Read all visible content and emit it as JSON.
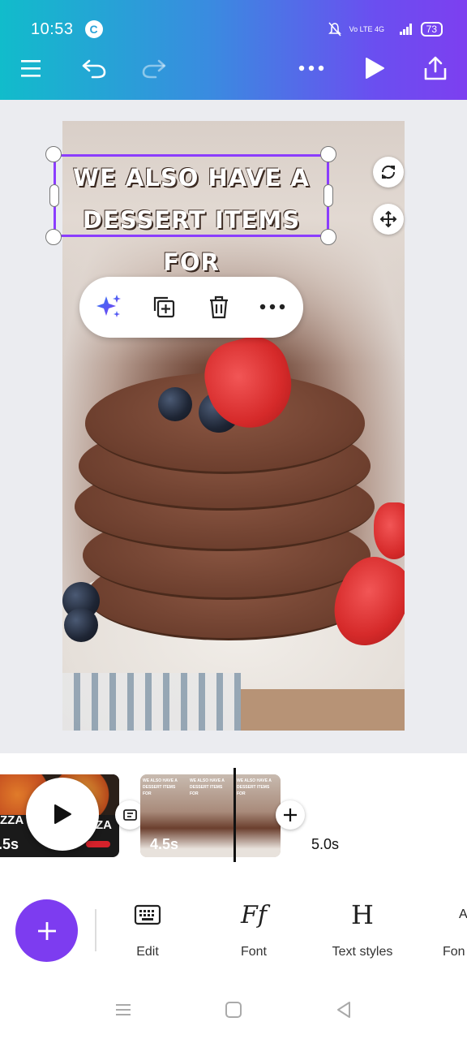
{
  "status_bar": {
    "time": "10:53",
    "app_badge": "C",
    "network": "Vo LTE 4G",
    "battery": "73"
  },
  "header": {
    "icons": [
      "menu-icon",
      "undo-icon",
      "redo-icon",
      "more-icon",
      "play-icon",
      "share-icon"
    ]
  },
  "canvas": {
    "text_line1": "WE ALSO HAVE A",
    "text_line2": "DESSERT ITEMS FOR"
  },
  "context_menu": {
    "icons": [
      "magic-sparkle-icon",
      "duplicate-icon",
      "delete-icon",
      "more-icon"
    ]
  },
  "timeline": {
    "clip1_duration": ".5s",
    "clip1_text_a": "ZZA",
    "clip1_text_b": "ZA",
    "clip2_duration": "4.5s",
    "thumb_text": "WE ALSO HAVE A DESSERT ITEMS FOR",
    "next_duration": "5.0s"
  },
  "tools": [
    {
      "label": "Edit",
      "icon": "keyboard-icon"
    },
    {
      "label": "Font",
      "icon": "font-icon"
    },
    {
      "label": "Text styles",
      "icon": "text-styles-icon"
    },
    {
      "label": "Fon",
      "icon": "font-size-icon"
    }
  ],
  "tool_glyphs": {
    "font": "Ff",
    "text_styles": "H",
    "font_size": "A"
  },
  "colors": {
    "accent": "#8b3dff",
    "fab": "#7d3cf0",
    "header_start": "#11bccb",
    "header_end": "#7d3ff0"
  }
}
